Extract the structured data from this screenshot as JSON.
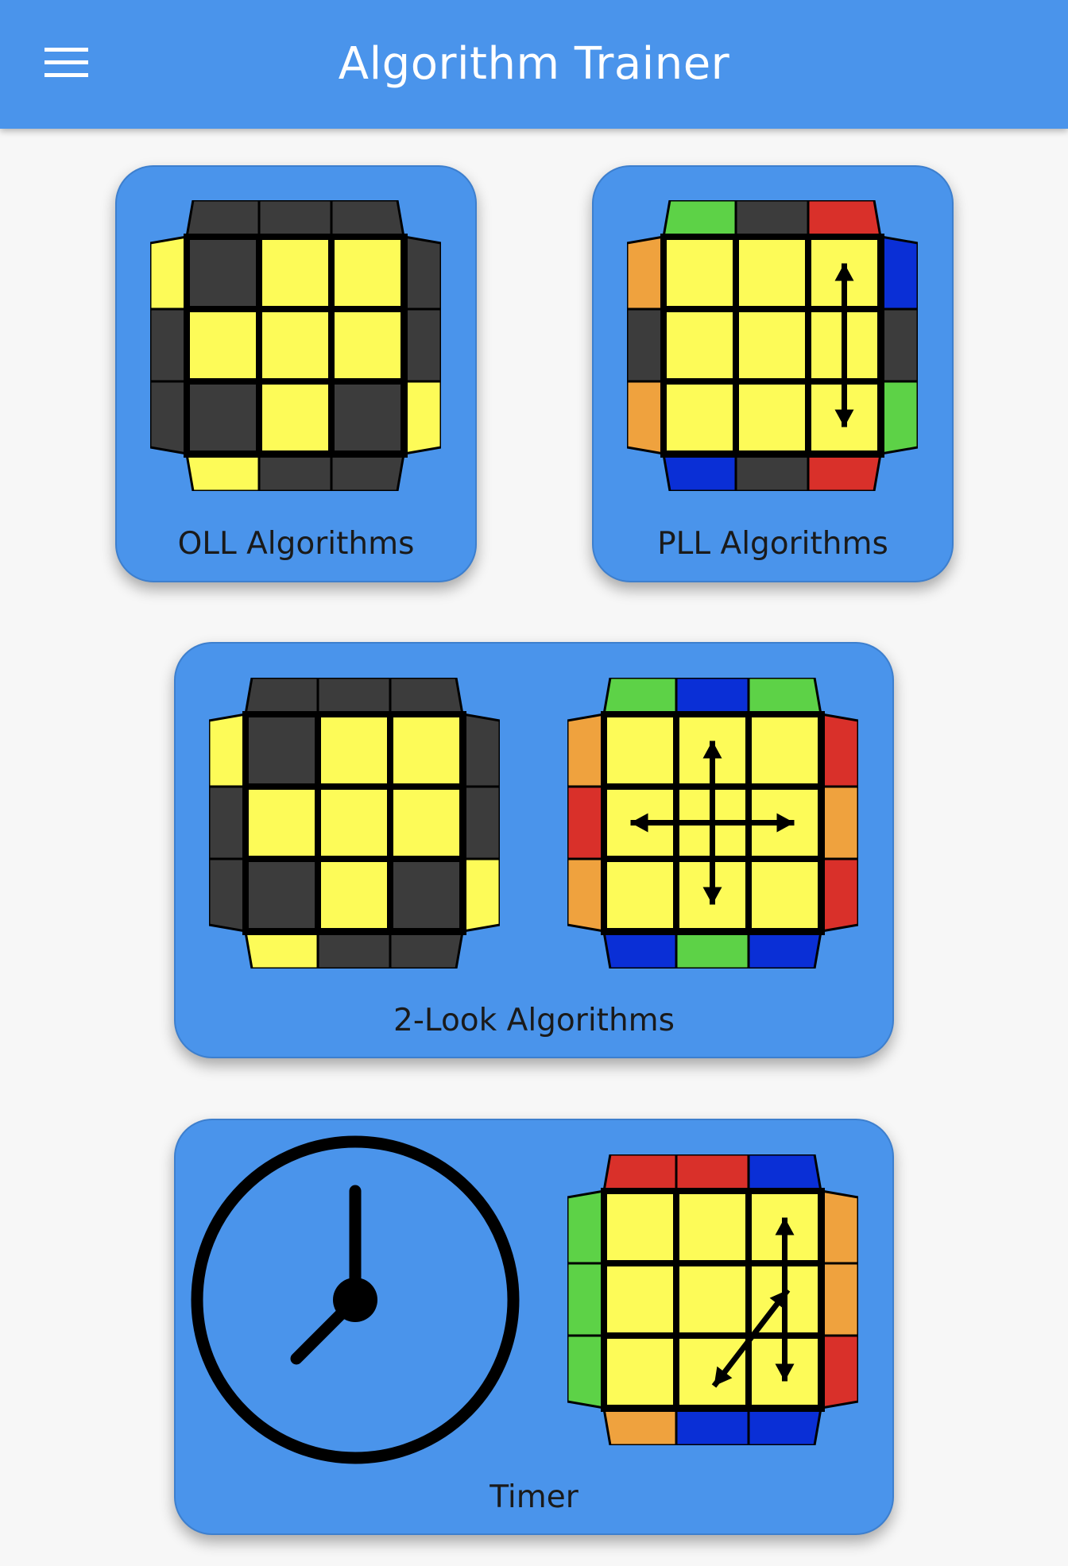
{
  "app_bar": {
    "title": "Algorithm Trainer",
    "menu_icon": "hamburger-menu-icon",
    "background": "#4a94eb"
  },
  "colors": {
    "yellow": "#fdfb58",
    "dark": "#3c3c3c",
    "green": "#5dd247",
    "red": "#d9302a",
    "blue": "#0a2fd6",
    "orange": "#efa23e",
    "card_background": "#4a94eb",
    "page_background": "#f7f7f7"
  },
  "cards": {
    "oll": {
      "label": "OLL Algorithms",
      "icon": "oll-cube-icon"
    },
    "pll": {
      "label": "PLL Algorithms",
      "icon": "pll-cube-icon"
    },
    "two_look": {
      "label": "2-Look Algorithms",
      "icons": [
        "oll-cube-icon",
        "pll-cube-icon"
      ]
    },
    "timer": {
      "label": "Timer",
      "icons": [
        "clock-icon",
        "pll-cube-icon"
      ]
    }
  },
  "cubes": {
    "oll": {
      "face": [
        [
          "D",
          "Y",
          "Y"
        ],
        [
          "Y",
          "Y",
          "Y"
        ],
        [
          "D",
          "Y",
          "D"
        ]
      ],
      "top": [
        "D",
        "D",
        "D"
      ],
      "bottom": [
        "Y",
        "D",
        "D"
      ],
      "left": [
        "Y",
        "D",
        "D"
      ],
      "right": [
        "D",
        "D",
        "Y"
      ],
      "arrows": "none"
    },
    "pll": {
      "face": [
        [
          "Y",
          "Y",
          "Y"
        ],
        [
          "Y",
          "Y",
          "Y"
        ],
        [
          "Y",
          "Y",
          "Y"
        ]
      ],
      "top": [
        "G",
        "D",
        "R"
      ],
      "bottom": [
        "B",
        "D",
        "R"
      ],
      "left": [
        "O",
        "D",
        "O"
      ],
      "right": [
        "B",
        "D",
        "G"
      ],
      "arrows": "vertical-right"
    },
    "two_look_oll": {
      "face": [
        [
          "D",
          "Y",
          "Y"
        ],
        [
          "Y",
          "Y",
          "Y"
        ],
        [
          "D",
          "Y",
          "D"
        ]
      ],
      "top": [
        "D",
        "D",
        "D"
      ],
      "bottom": [
        "Y",
        "D",
        "D"
      ],
      "left": [
        "Y",
        "D",
        "D"
      ],
      "right": [
        "D",
        "D",
        "Y"
      ],
      "arrows": "none"
    },
    "two_look_pll": {
      "face": [
        [
          "Y",
          "Y",
          "Y"
        ],
        [
          "Y",
          "Y",
          "Y"
        ],
        [
          "Y",
          "Y",
          "Y"
        ]
      ],
      "top": [
        "G",
        "B",
        "G"
      ],
      "bottom": [
        "B",
        "G",
        "B"
      ],
      "left": [
        "O",
        "R",
        "O"
      ],
      "right": [
        "R",
        "O",
        "R"
      ],
      "arrows": "cross"
    },
    "timer_pll": {
      "face": [
        [
          "Y",
          "Y",
          "Y"
        ],
        [
          "Y",
          "Y",
          "Y"
        ],
        [
          "Y",
          "Y",
          "Y"
        ]
      ],
      "top": [
        "R",
        "R",
        "B"
      ],
      "bottom": [
        "O",
        "B",
        "B"
      ],
      "left": [
        "G",
        "G",
        "G"
      ],
      "right": [
        "O",
        "O",
        "R"
      ],
      "arrows": "vertical-and-diagonal"
    }
  }
}
